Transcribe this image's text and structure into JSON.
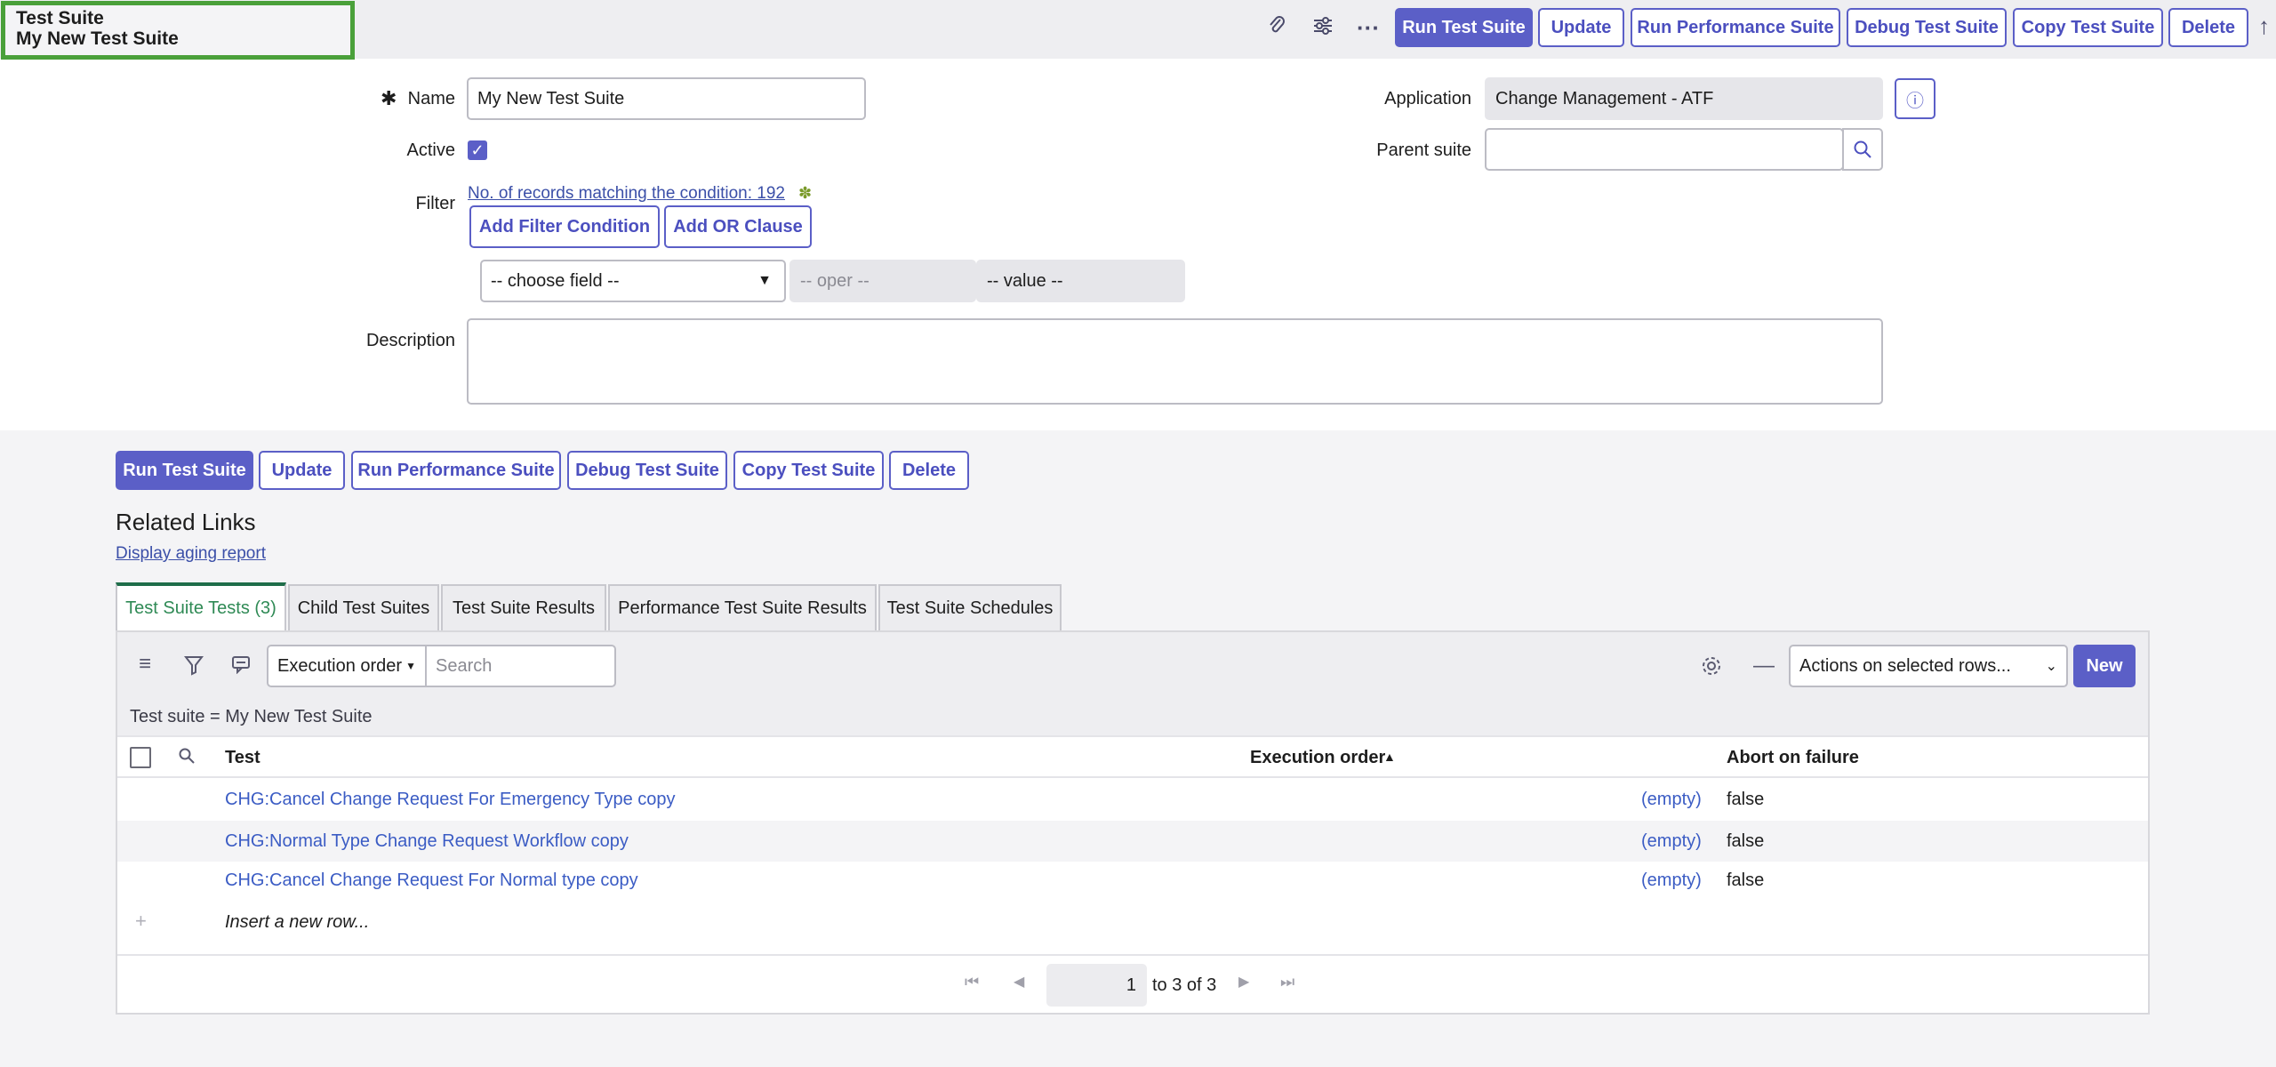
{
  "header": {
    "record_type": "Test Suite",
    "record_name": "My New Test Suite",
    "icons": [
      "paperclip-icon",
      "sliders-icon",
      "more-icon",
      "scroll-up-icon"
    ],
    "buttons": {
      "run": "Run Test Suite",
      "update": "Update",
      "run_perf": "Run Performance Suite",
      "debug": "Debug Test Suite",
      "copy": "Copy Test Suite",
      "delete": "Delete"
    }
  },
  "form": {
    "name_label": "Name",
    "required_mark": "✱",
    "name_value": "My New Test Suite",
    "active_label": "Active",
    "active_checked": true,
    "filter_label": "Filter",
    "filter_link": "No. of records matching the condition: 192",
    "add_filter": "Add Filter Condition",
    "add_or": "Add OR Clause",
    "choose_field": "-- choose field --",
    "oper": "-- oper --",
    "value": "-- value --",
    "description_label": "Description",
    "description_value": "",
    "application_label": "Application",
    "application_value": "Change Management - ATF",
    "parent_label": "Parent suite",
    "parent_value": ""
  },
  "bottom_buttons": {
    "run": "Run Test Suite",
    "update": "Update",
    "run_perf": "Run Performance Suite",
    "debug": "Debug Test Suite",
    "copy": "Copy Test Suite",
    "delete": "Delete"
  },
  "related": {
    "heading": "Related Links",
    "aging_link": "Display aging report"
  },
  "tabs": [
    {
      "label": "Test Suite Tests (3)",
      "active": true
    },
    {
      "label": "Child Test Suites",
      "active": false
    },
    {
      "label": "Test Suite Results",
      "active": false
    },
    {
      "label": "Performance Test Suite Results",
      "active": false
    },
    {
      "label": "Test Suite Schedules",
      "active": false
    }
  ],
  "list": {
    "sort_field": "Execution order",
    "search_placeholder": "Search",
    "actions_select": "Actions on selected rows...",
    "new_button": "New",
    "breadcrumb": "Test suite = My New Test Suite",
    "columns": [
      "Test",
      "Execution order",
      "Abort on failure"
    ],
    "rows": [
      {
        "test": "CHG:Cancel Change Request For Emergency Type copy",
        "order": "(empty)",
        "abort": "false"
      },
      {
        "test": "CHG:Normal Type Change Request Workflow copy",
        "order": "(empty)",
        "abort": "false"
      },
      {
        "test": "CHG:Cancel Change Request For Normal type copy",
        "order": "(empty)",
        "abort": "false"
      }
    ],
    "insert_row": "Insert a new row...",
    "pagination": {
      "page": "1",
      "range": "to 3 of 3"
    }
  },
  "colors": {
    "accent": "#5b5fc7",
    "active_tab": "#2f8a55",
    "highlight": "#4aa03a"
  }
}
